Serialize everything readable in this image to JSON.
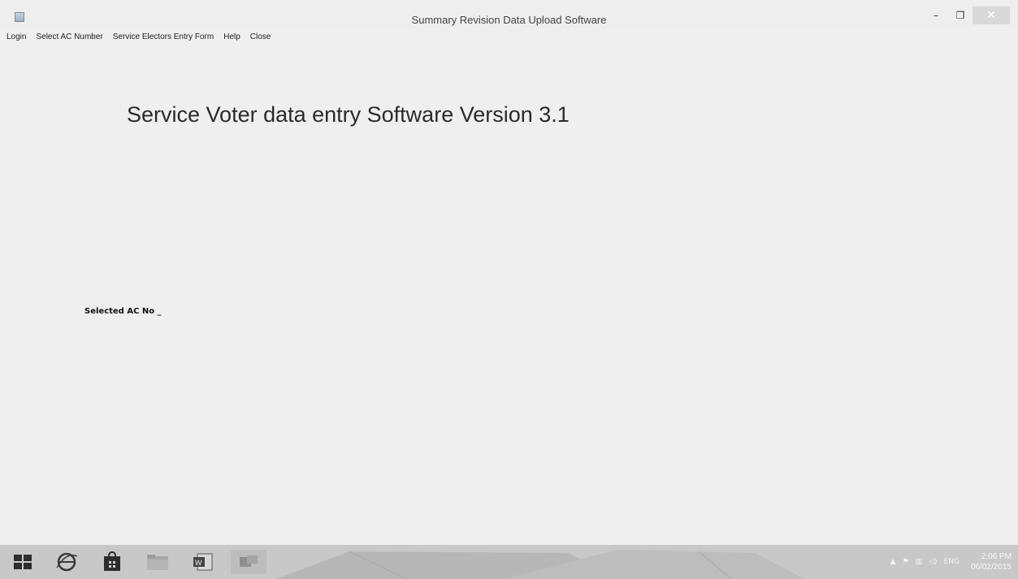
{
  "window": {
    "title": "Summary Revision Data Upload Software",
    "controls": {
      "minimize": "–",
      "restore": "❐",
      "close": "✕"
    }
  },
  "menu": [
    {
      "label": "Login"
    },
    {
      "label": "Select AC Number"
    },
    {
      "label": "Service Electors Entry Form"
    },
    {
      "label": "Help"
    },
    {
      "label": "Close"
    }
  ],
  "main": {
    "heading": "Service Voter data entry Software Version 3.1",
    "selected_ac_label": "Selected AC No _"
  },
  "taskbar": {
    "apps": [
      {
        "icon": "windows-start-icon"
      },
      {
        "icon": "internet-explorer-icon"
      },
      {
        "icon": "store-icon"
      },
      {
        "icon": "file-explorer-icon"
      },
      {
        "icon": "word-icon"
      },
      {
        "icon": "app-window-icon"
      }
    ],
    "tray": {
      "language": "ENG",
      "time": "2:06 PM",
      "date": "06/02/2015"
    }
  },
  "colors": {
    "background": "#efefef",
    "taskbar": "#c8c8c8",
    "close_button": "#d9d9d9"
  }
}
